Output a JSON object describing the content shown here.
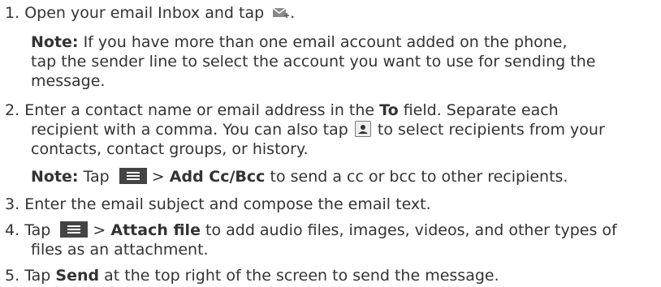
{
  "steps": [
    {
      "num": "1.",
      "t1": "Open your email Inbox and tap",
      "t2": "."
    },
    {
      "num": "2.",
      "l1": "Enter a contact name or email address in the",
      "bold": "To",
      "l1b": "field. Separate each",
      "l2a": "recipient with a comma. You can also tap",
      "l2b": "to select recipients from your",
      "l3": "contacts, contact groups, or history."
    },
    {
      "num": "3.",
      "text": "Enter the email subject and compose the email text."
    },
    {
      "num": "4.",
      "pre": "Tap",
      "bold": "Attach file",
      "post": "to add audio files, images, videos, and other types of",
      "l2": "files as an attachment."
    },
    {
      "num": "5.",
      "pre": "Tap",
      "bold": "Send",
      "post": "at the top right of the screen to send the message."
    }
  ],
  "note1": {
    "label": "Note:",
    "l1": "If you have more than one email account added on the phone,",
    "l2": "tap the sender line to select the account you want to use for sending the",
    "l3": "message."
  },
  "note2": {
    "label": "Note:",
    "pre": "Tap",
    "gt": ">",
    "bold": "Add Cc/Bcc",
    "post": "to send a cc or bcc to other recipients."
  },
  "gt": ">"
}
